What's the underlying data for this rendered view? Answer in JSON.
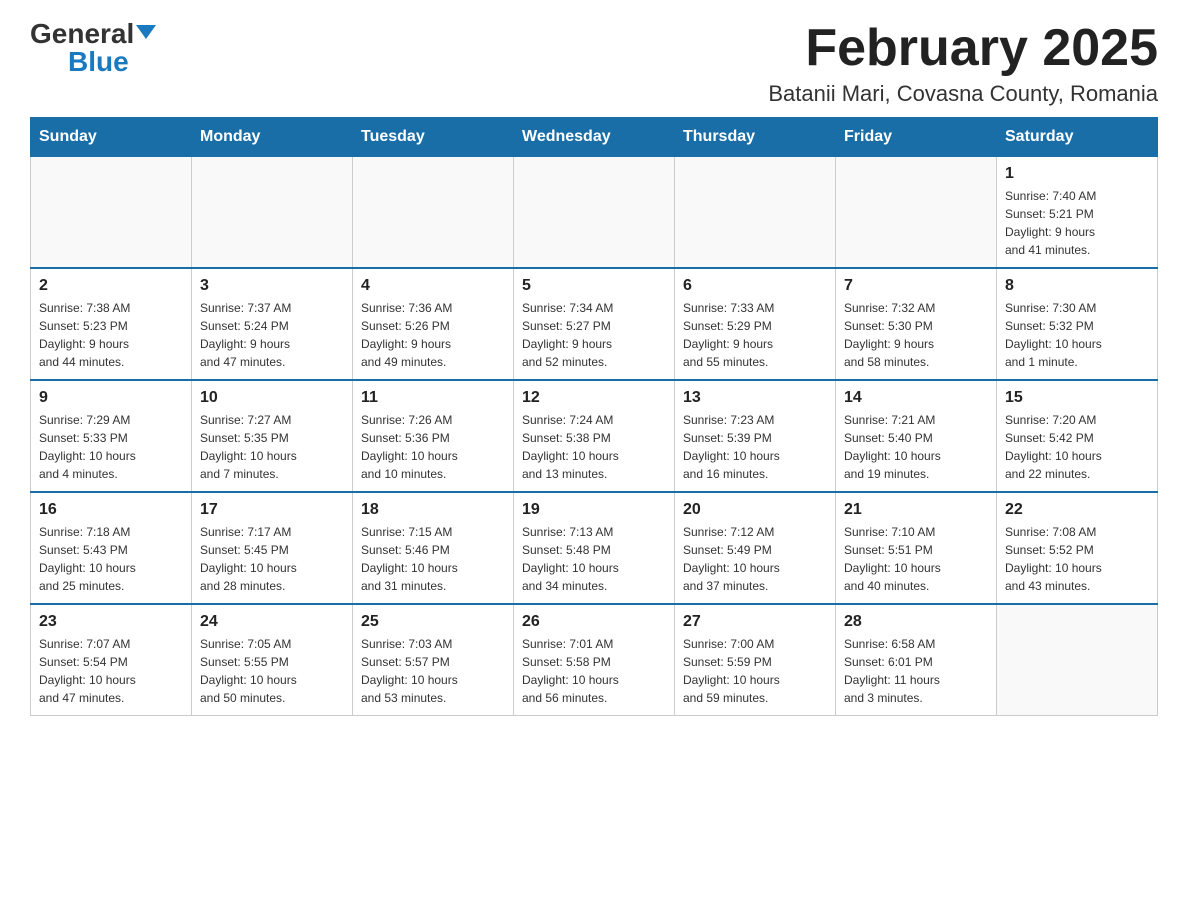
{
  "header": {
    "logo_general": "General",
    "logo_blue": "Blue",
    "month_title": "February 2025",
    "location": "Batanii Mari, Covasna County, Romania"
  },
  "weekdays": [
    "Sunday",
    "Monday",
    "Tuesday",
    "Wednesday",
    "Thursday",
    "Friday",
    "Saturday"
  ],
  "weeks": [
    [
      {
        "day": "",
        "info": ""
      },
      {
        "day": "",
        "info": ""
      },
      {
        "day": "",
        "info": ""
      },
      {
        "day": "",
        "info": ""
      },
      {
        "day": "",
        "info": ""
      },
      {
        "day": "",
        "info": ""
      },
      {
        "day": "1",
        "info": "Sunrise: 7:40 AM\nSunset: 5:21 PM\nDaylight: 9 hours\nand 41 minutes."
      }
    ],
    [
      {
        "day": "2",
        "info": "Sunrise: 7:38 AM\nSunset: 5:23 PM\nDaylight: 9 hours\nand 44 minutes."
      },
      {
        "day": "3",
        "info": "Sunrise: 7:37 AM\nSunset: 5:24 PM\nDaylight: 9 hours\nand 47 minutes."
      },
      {
        "day": "4",
        "info": "Sunrise: 7:36 AM\nSunset: 5:26 PM\nDaylight: 9 hours\nand 49 minutes."
      },
      {
        "day": "5",
        "info": "Sunrise: 7:34 AM\nSunset: 5:27 PM\nDaylight: 9 hours\nand 52 minutes."
      },
      {
        "day": "6",
        "info": "Sunrise: 7:33 AM\nSunset: 5:29 PM\nDaylight: 9 hours\nand 55 minutes."
      },
      {
        "day": "7",
        "info": "Sunrise: 7:32 AM\nSunset: 5:30 PM\nDaylight: 9 hours\nand 58 minutes."
      },
      {
        "day": "8",
        "info": "Sunrise: 7:30 AM\nSunset: 5:32 PM\nDaylight: 10 hours\nand 1 minute."
      }
    ],
    [
      {
        "day": "9",
        "info": "Sunrise: 7:29 AM\nSunset: 5:33 PM\nDaylight: 10 hours\nand 4 minutes."
      },
      {
        "day": "10",
        "info": "Sunrise: 7:27 AM\nSunset: 5:35 PM\nDaylight: 10 hours\nand 7 minutes."
      },
      {
        "day": "11",
        "info": "Sunrise: 7:26 AM\nSunset: 5:36 PM\nDaylight: 10 hours\nand 10 minutes."
      },
      {
        "day": "12",
        "info": "Sunrise: 7:24 AM\nSunset: 5:38 PM\nDaylight: 10 hours\nand 13 minutes."
      },
      {
        "day": "13",
        "info": "Sunrise: 7:23 AM\nSunset: 5:39 PM\nDaylight: 10 hours\nand 16 minutes."
      },
      {
        "day": "14",
        "info": "Sunrise: 7:21 AM\nSunset: 5:40 PM\nDaylight: 10 hours\nand 19 minutes."
      },
      {
        "day": "15",
        "info": "Sunrise: 7:20 AM\nSunset: 5:42 PM\nDaylight: 10 hours\nand 22 minutes."
      }
    ],
    [
      {
        "day": "16",
        "info": "Sunrise: 7:18 AM\nSunset: 5:43 PM\nDaylight: 10 hours\nand 25 minutes."
      },
      {
        "day": "17",
        "info": "Sunrise: 7:17 AM\nSunset: 5:45 PM\nDaylight: 10 hours\nand 28 minutes."
      },
      {
        "day": "18",
        "info": "Sunrise: 7:15 AM\nSunset: 5:46 PM\nDaylight: 10 hours\nand 31 minutes."
      },
      {
        "day": "19",
        "info": "Sunrise: 7:13 AM\nSunset: 5:48 PM\nDaylight: 10 hours\nand 34 minutes."
      },
      {
        "day": "20",
        "info": "Sunrise: 7:12 AM\nSunset: 5:49 PM\nDaylight: 10 hours\nand 37 minutes."
      },
      {
        "day": "21",
        "info": "Sunrise: 7:10 AM\nSunset: 5:51 PM\nDaylight: 10 hours\nand 40 minutes."
      },
      {
        "day": "22",
        "info": "Sunrise: 7:08 AM\nSunset: 5:52 PM\nDaylight: 10 hours\nand 43 minutes."
      }
    ],
    [
      {
        "day": "23",
        "info": "Sunrise: 7:07 AM\nSunset: 5:54 PM\nDaylight: 10 hours\nand 47 minutes."
      },
      {
        "day": "24",
        "info": "Sunrise: 7:05 AM\nSunset: 5:55 PM\nDaylight: 10 hours\nand 50 minutes."
      },
      {
        "day": "25",
        "info": "Sunrise: 7:03 AM\nSunset: 5:57 PM\nDaylight: 10 hours\nand 53 minutes."
      },
      {
        "day": "26",
        "info": "Sunrise: 7:01 AM\nSunset: 5:58 PM\nDaylight: 10 hours\nand 56 minutes."
      },
      {
        "day": "27",
        "info": "Sunrise: 7:00 AM\nSunset: 5:59 PM\nDaylight: 10 hours\nand 59 minutes."
      },
      {
        "day": "28",
        "info": "Sunrise: 6:58 AM\nSunset: 6:01 PM\nDaylight: 11 hours\nand 3 minutes."
      },
      {
        "day": "",
        "info": ""
      }
    ]
  ]
}
